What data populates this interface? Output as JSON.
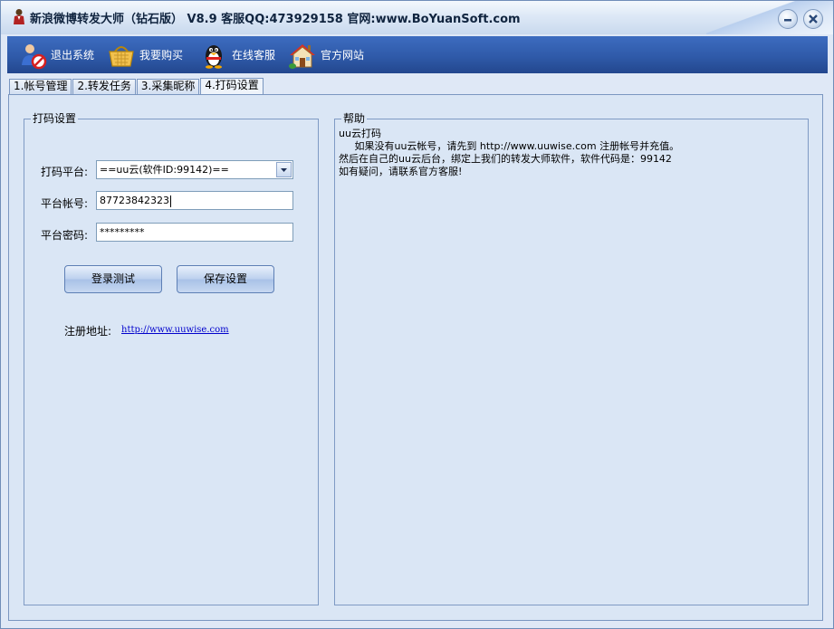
{
  "window": {
    "title": "新浪微博转发大师（钻石版） V8.9 客服QQ:473929158 官网:www.BoYuanSoft.com",
    "minimize_icon": "minimize-icon",
    "close_icon": "close-icon"
  },
  "toolbar": {
    "items": [
      {
        "label": "退出系统",
        "icon": "exit-user-icon"
      },
      {
        "label": "我要购买",
        "icon": "shopping-basket-icon"
      },
      {
        "label": "在线客服",
        "icon": "qq-penguin-icon"
      },
      {
        "label": "官方网站",
        "icon": "home-icon"
      }
    ]
  },
  "tabs": [
    {
      "label": "1.帐号管理",
      "active": false
    },
    {
      "label": "2.转发任务",
      "active": false
    },
    {
      "label": "3.采集昵称",
      "active": false
    },
    {
      "label": "4.打码设置",
      "active": true
    }
  ],
  "captcha_group": {
    "legend": "打码设置",
    "platform_label": "打码平台:",
    "platform_value": "==uu云(软件ID:99142)==",
    "account_label": "平台帐号:",
    "account_value": "87723842323",
    "password_label": "平台密码:",
    "password_value": "*********",
    "login_test_button": "登录测试",
    "save_button": "保存设置",
    "register_label": "注册地址:",
    "register_link": "http://www.uuwise.com"
  },
  "help_group": {
    "legend": "帮助",
    "lines": [
      "uu云打码",
      "     如果没有uu云帐号，请先到 http://www.uuwise.com 注册帐号并充值。",
      "然后在自己的uu云后台，绑定上我们的转发大师软件，软件代码是：99142",
      "如有疑问，请联系官方客服!"
    ]
  },
  "colors": {
    "toolbar_bg": "#2f5aa9",
    "panel_bg": "#dae6f5",
    "border": "#7a96c0",
    "link": "#0000cc"
  }
}
